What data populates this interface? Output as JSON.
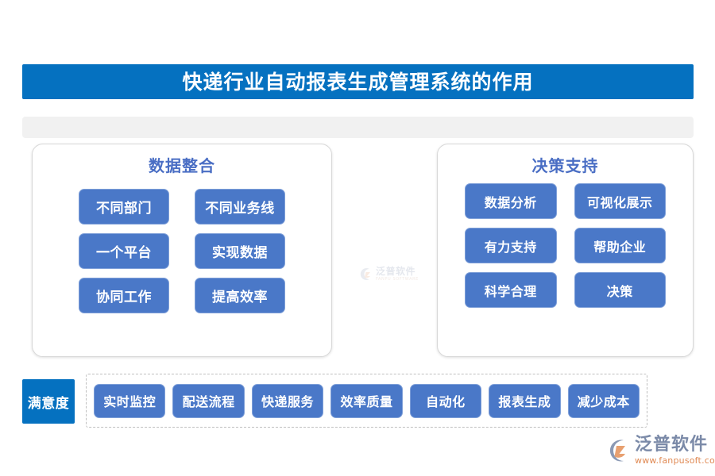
{
  "page": {
    "background_color": "#ffffff",
    "title_bar_color": "#0571c0",
    "pill_color": "#4a78c8",
    "heading_color": "#4a6ec4"
  },
  "header": {
    "title": "快递行业自动报表生成管理系统的作用"
  },
  "subbar": {
    "text": ""
  },
  "panels": [
    {
      "heading": "数据整合",
      "items": [
        {
          "label": "不同部门"
        },
        {
          "label": "不同业务线"
        },
        {
          "label": "一个平台"
        },
        {
          "label": "实现数据"
        },
        {
          "label": "协同工作"
        },
        {
          "label": "提高效率"
        }
      ]
    },
    {
      "heading": "决策支持",
      "items": [
        {
          "label": "数据分析"
        },
        {
          "label": "可视化展示"
        },
        {
          "label": "有力支持"
        },
        {
          "label": "帮助企业"
        },
        {
          "label": "科学合理"
        },
        {
          "label": "决策"
        }
      ]
    }
  ],
  "bottom": {
    "badge_label": "满意度",
    "chips": [
      {
        "label": "实时监控"
      },
      {
        "label": "配送流程"
      },
      {
        "label": "快递服务"
      },
      {
        "label": "效率质量"
      },
      {
        "label": "自动化"
      },
      {
        "label": "报表生成"
      },
      {
        "label": "减少成本"
      }
    ]
  },
  "watermark": {
    "brand_cn": "泛普软件",
    "brand_en": "FANPU SOFTWARE"
  },
  "logo": {
    "brand_cn": "泛普软件",
    "url": "www.fanpusoft.com"
  }
}
